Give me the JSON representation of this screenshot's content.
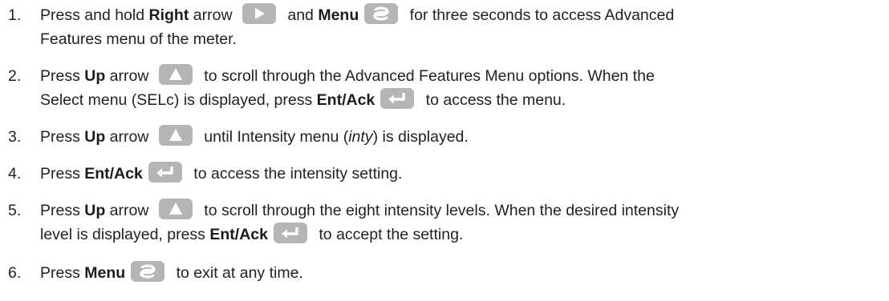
{
  "steps": [
    {
      "num": "1.",
      "line1": [
        {
          "t": "Press and hold "
        },
        {
          "b": "Right"
        },
        {
          "t": " arrow "
        },
        {
          "icon": "right"
        },
        {
          "t": " and "
        },
        {
          "b": "Menu"
        },
        {
          "icon": "menu"
        },
        {
          "t": " for three seconds to access Advanced"
        }
      ],
      "line2": [
        {
          "t": "Features menu of the meter."
        }
      ]
    },
    {
      "num": "2.",
      "line1": [
        {
          "t": "Press "
        },
        {
          "b": "Up"
        },
        {
          "t": " arrow "
        },
        {
          "icon": "up"
        },
        {
          "t": " to scroll through the Advanced Features Menu options. When the"
        }
      ],
      "line2": [
        {
          "t": "Select menu (SELc) is displayed, press "
        },
        {
          "b": "Ent/Ack"
        },
        {
          "icon": "enter"
        },
        {
          "t": " to access the menu."
        }
      ]
    },
    {
      "num": "3.",
      "line1": [
        {
          "t": "Press "
        },
        {
          "b": "Up"
        },
        {
          "t": " arrow "
        },
        {
          "icon": "up"
        },
        {
          "t": " until Intensity menu ("
        },
        {
          "i": "inty"
        },
        {
          "t": ") is displayed."
        }
      ]
    },
    {
      "num": "4.",
      "line1": [
        {
          "t": "Press "
        },
        {
          "b": "Ent/Ack"
        },
        {
          "icon": "enter"
        },
        {
          "t": " to access the intensity setting."
        }
      ]
    },
    {
      "num": "5.",
      "line1": [
        {
          "t": "Press "
        },
        {
          "b": "Up"
        },
        {
          "t": " arrow "
        },
        {
          "icon": "up"
        },
        {
          "t": " to scroll through the eight intensity levels. When the desired intensity"
        }
      ],
      "line2": [
        {
          "t": "level is displayed, press "
        },
        {
          "b": "Ent/Ack"
        },
        {
          "icon": "enter"
        },
        {
          "t": " to accept the setting."
        }
      ]
    },
    {
      "num": "6.",
      "line1": [
        {
          "t": "Press "
        },
        {
          "b": "Menu"
        },
        {
          "icon": "menu"
        },
        {
          "t": " to exit at any time."
        }
      ]
    }
  ],
  "icon_names": {
    "right": "right-arrow-key-icon",
    "up": "up-arrow-key-icon",
    "enter": "enter-key-icon",
    "menu": "menu-key-icon"
  },
  "colors": {
    "text": "#222222",
    "key_background": "#b5b5b5",
    "key_glyph": "#ffffff"
  }
}
